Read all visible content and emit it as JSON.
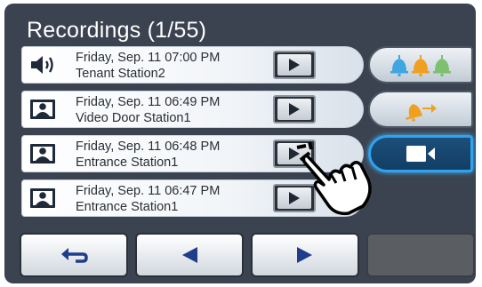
{
  "header": {
    "title": "Recordings (1/55)"
  },
  "recordings": [
    {
      "date": "Friday, Sep. 11 07:00 PM",
      "station": "Tenant Station2",
      "type_icon": "speaker-icon"
    },
    {
      "date": "Friday, Sep. 11 06:49 PM",
      "station": "Video Door Station1",
      "type_icon": "video-person-icon"
    },
    {
      "date": "Friday, Sep. 11 06:48 PM",
      "station": "Entrance Station1",
      "type_icon": "video-person-icon"
    },
    {
      "date": "Friday, Sep. 11 06:47 PM",
      "station": "Entrance Station1",
      "type_icon": "video-person-icon"
    }
  ],
  "side_buttons": [
    {
      "icon": "bells-icon"
    },
    {
      "icon": "bell-transfer-icon"
    },
    {
      "icon": "video-camera-icon",
      "active": true
    }
  ],
  "nav": [
    {
      "icon": "back-arrow-icon"
    },
    {
      "icon": "prev-arrow-icon"
    },
    {
      "icon": "next-arrow-icon"
    },
    {
      "icon": "",
      "disabled": true
    }
  ],
  "colors": {
    "panel": "#3b4350",
    "active_border": "#2fa3f0",
    "bell_blue": "#3fa6e0",
    "bell_orange": "#f0a020",
    "bell_green": "#7cc070"
  }
}
